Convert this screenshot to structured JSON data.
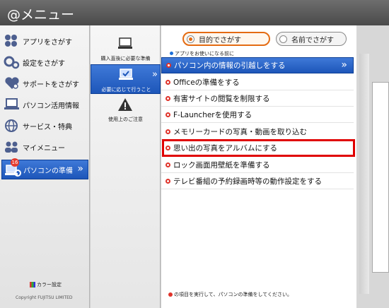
{
  "window": {
    "title": "@メニュー"
  },
  "nav": {
    "items": [
      {
        "label": "アプリをさがす",
        "icon": "apps-icon"
      },
      {
        "label": "設定をさがす",
        "icon": "gears-icon"
      },
      {
        "label": "サポートをさがす",
        "icon": "heart-icon"
      },
      {
        "label": "パソコン活用情報",
        "icon": "laptop-icon"
      },
      {
        "label": "サービス・特典",
        "icon": "globe-icon"
      },
      {
        "label": "マイメニュー",
        "icon": "people-icon"
      },
      {
        "label": "パソコンの準備",
        "icon": "laptop-gear-icon",
        "badge": "16",
        "active": true
      }
    ],
    "color_setting": "カラー設定",
    "copyright": "Copyright FUJITSU LIMITED"
  },
  "mid": {
    "items": [
      {
        "label": "購入直後に必要な準備",
        "icon": "computer-icon"
      },
      {
        "label": "必要に応じて行うこと",
        "icon": "computer-check-icon",
        "active": true
      },
      {
        "label": "使用上のご注意",
        "icon": "warning-icon"
      }
    ]
  },
  "search": {
    "by_purpose": "目的でさがす",
    "by_name": "名前でさがす"
  },
  "hint": "アプリをお使いになる前に",
  "menu": [
    "パソコン内の情報の引越しをする",
    "Officeの準備をする",
    "有害サイトの閲覧を制限する",
    "F-Launcherを使用する",
    "メモリーカードの写真・動画を取り込む",
    "思い出の写真をアルバムにする",
    "ロック画面用壁紙を準備する",
    "テレビ番組の予約録画時等の動作設定をする"
  ],
  "footnote": "の項目を実行して、パソコンの準備をしてください。",
  "colors": {
    "accent": "#1d56b9",
    "highlight": "#e00000",
    "marker": "#e0332a"
  }
}
